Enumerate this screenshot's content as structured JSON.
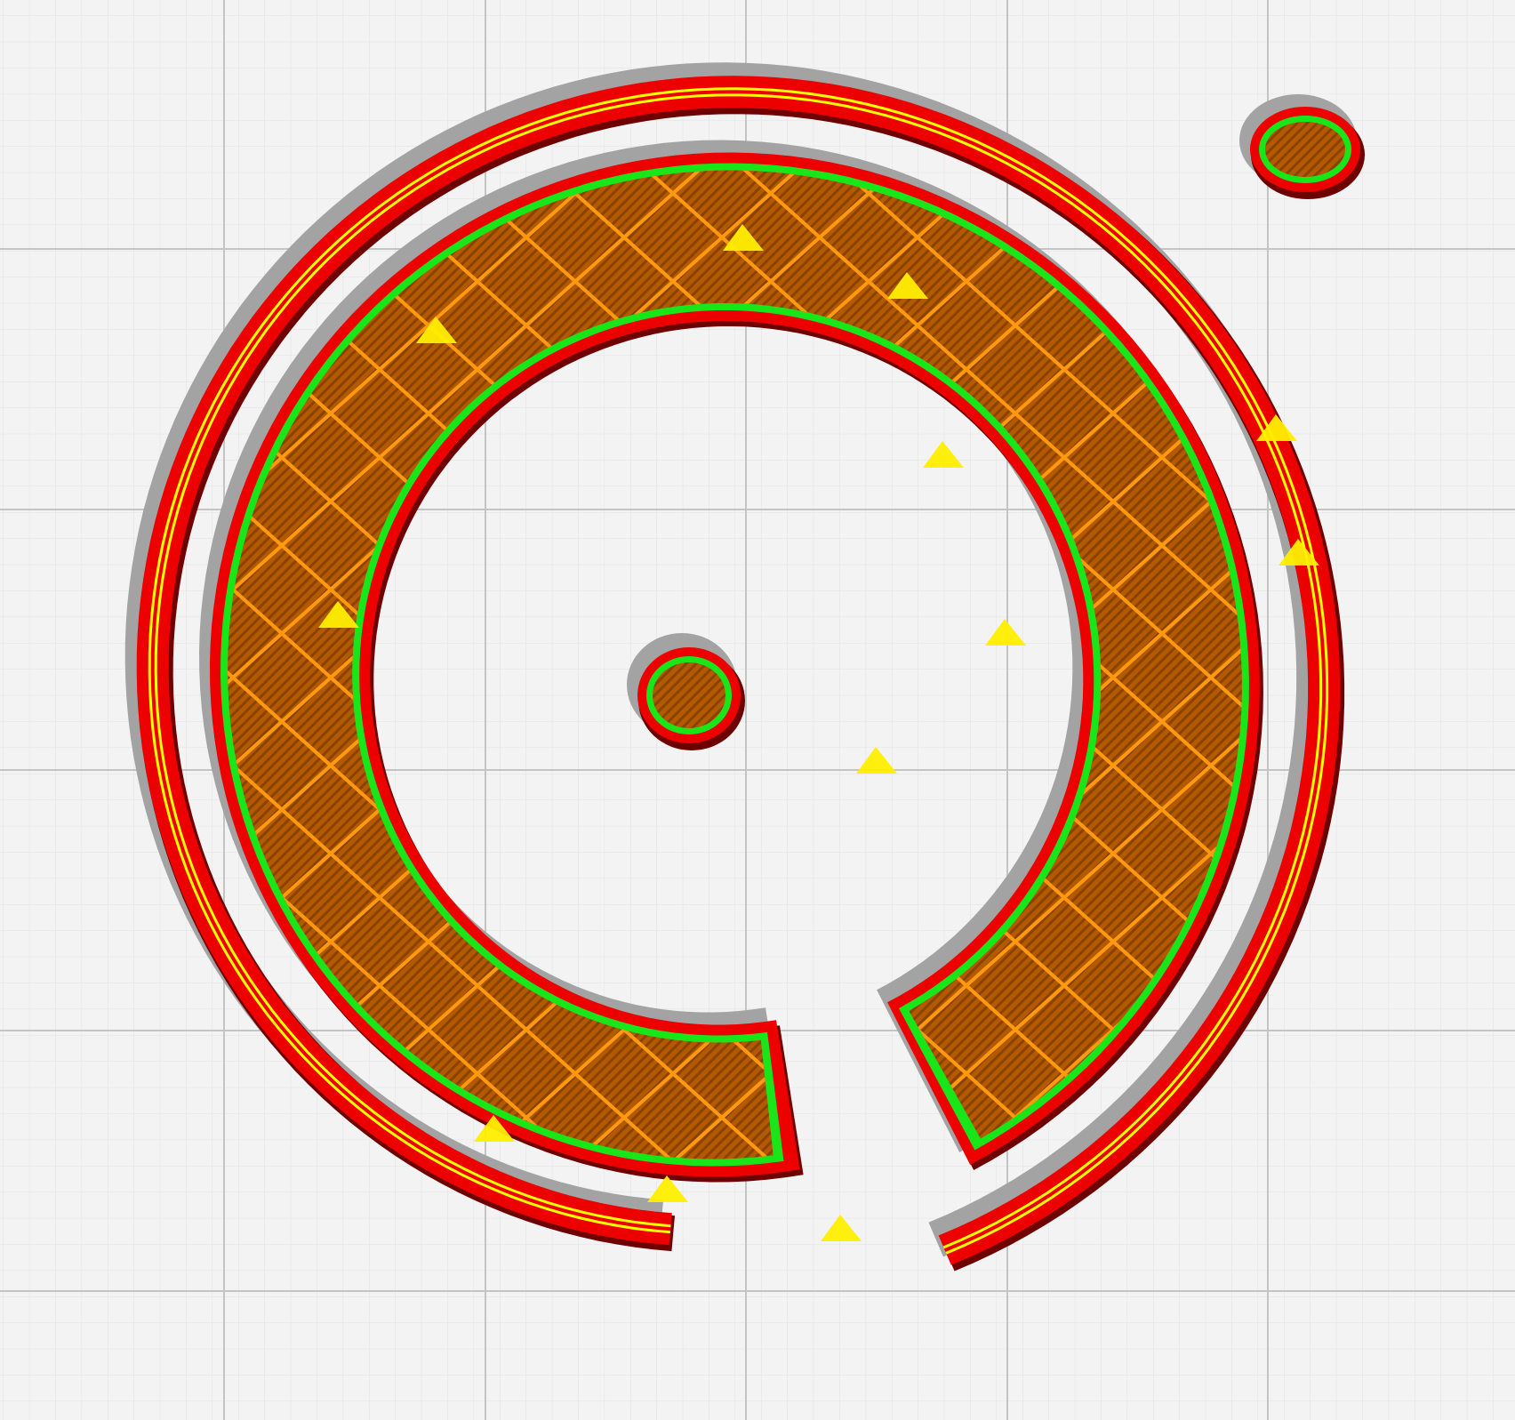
{
  "viewport": {
    "view": "layer-view",
    "background_color": "#f3f3f3",
    "grid": {
      "minor_color": "#e2e2e2",
      "major_color": "#c4c4c4"
    }
  },
  "model": {
    "shape": "spiral",
    "colors": {
      "shadow": "#a3a3a3",
      "wall_outer_dark": "#6e0000",
      "wall_outer": "#ec0000",
      "wall_inner": "#19e619",
      "skin_line": "#ffff00",
      "infill": "#b85c00",
      "infill_lines": "#ff9a10",
      "top_bottom": "#ffee00"
    }
  }
}
